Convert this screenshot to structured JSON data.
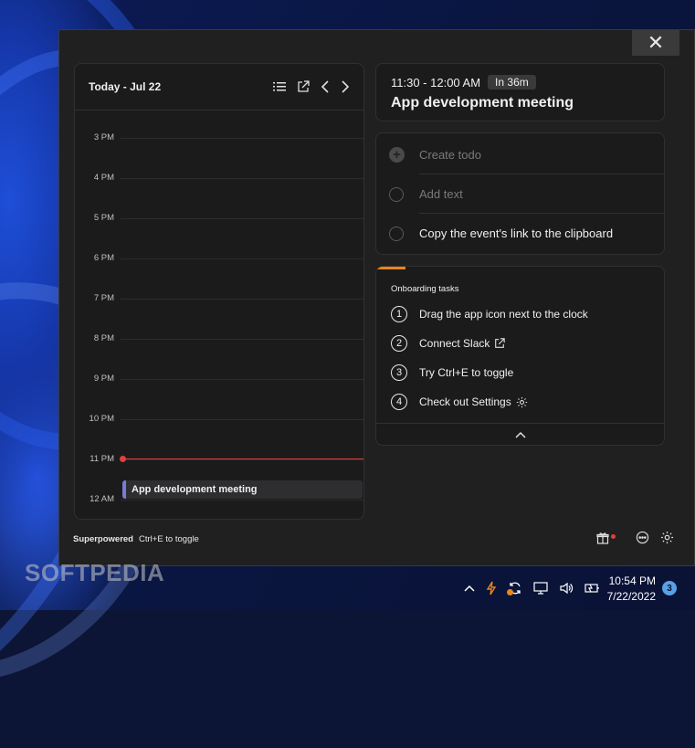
{
  "window": {
    "close_icon": "close-icon"
  },
  "calendar": {
    "title": "Today - Jul 22",
    "header_icons": [
      "list-icon",
      "external-link-icon",
      "chevron-left-icon",
      "chevron-right-icon"
    ],
    "hours": [
      "3 PM",
      "4 PM",
      "5 PM",
      "6 PM",
      "7 PM",
      "8 PM",
      "9 PM",
      "10 PM",
      "11 PM",
      "12 AM"
    ],
    "event_label": "App development meeting"
  },
  "event": {
    "time": "11:30 - 12:00 AM",
    "badge": "In 36m",
    "title": "App development meeting"
  },
  "todo": {
    "create": "Create todo",
    "add_text": "Add text",
    "copy_link": "Copy the event's link to the clipboard"
  },
  "onboarding": {
    "title": "Onboarding tasks",
    "progress": 0.1,
    "steps": [
      {
        "num": "1",
        "label": "Drag the app icon next to the clock"
      },
      {
        "num": "2",
        "label": "Connect Slack"
      },
      {
        "num": "3",
        "label": "Try Ctrl+E to toggle"
      },
      {
        "num": "4",
        "label": "Check out Settings"
      }
    ]
  },
  "footer": {
    "brand": "Superpowered",
    "hint": "Ctrl+E to toggle",
    "icons": [
      "gift-icon",
      "chat-icon",
      "gear-icon"
    ]
  },
  "watermark": "SOFTPEDIA",
  "taskbar": {
    "time": "10:54 PM",
    "date": "7/22/2022",
    "notifications": "3"
  },
  "colors": {
    "accent": "#e8861c",
    "now_line": "#e04040",
    "event_bar": "#7a7ad8"
  }
}
